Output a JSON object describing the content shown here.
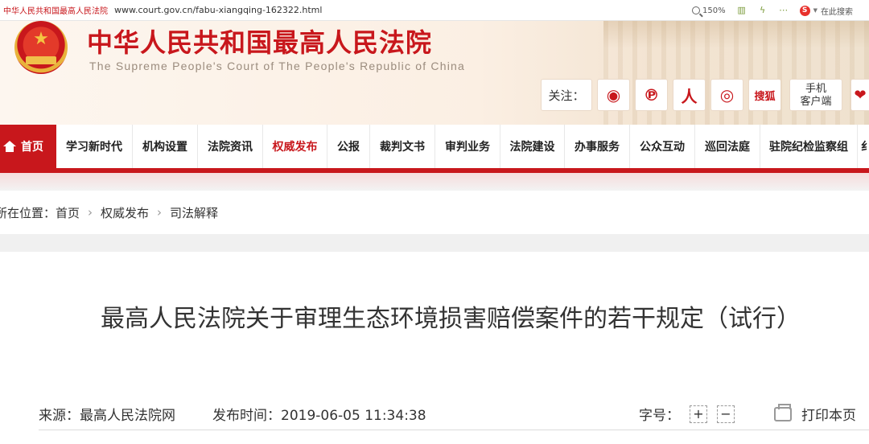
{
  "browser": {
    "tab_title": "中华人民共和国最高人民法院",
    "url": "www.court.gov.cn/fabu-xiangqing-162322.html",
    "zoom": "150%",
    "search_label": "在此搜索"
  },
  "header": {
    "title": "中华人民共和国最高人民法院",
    "subtitle": "The Supreme People's Court of The People's Republic of China",
    "follow_label": "关注：",
    "social": [
      {
        "name": "weibo-icon",
        "glyph": "◉"
      },
      {
        "name": "pinterest-icon",
        "glyph": "℗"
      },
      {
        "name": "renmin-icon",
        "glyph": "人"
      },
      {
        "name": "wechat-icon",
        "glyph": "◎"
      },
      {
        "name": "sohu-icon",
        "glyph": "搜狐"
      }
    ],
    "mobile_line1": "手机",
    "mobile_line2": "客户端"
  },
  "nav": {
    "home": "首页",
    "items": [
      "学习新时代",
      "机构设置",
      "法院资讯",
      "权威发布",
      "公报",
      "裁判文书",
      "审判业务",
      "法院建设",
      "办事服务",
      "公众互动",
      "巡回法庭",
      "驻院纪检监察组"
    ],
    "active": "权威发布",
    "overflow": "纟"
  },
  "breadcrumb": {
    "prefix": "所在位置：",
    "items": [
      "首页",
      "权威发布",
      "司法解释"
    ]
  },
  "article": {
    "title": "最高人民法院关于审理生态环境损害赔偿案件的若干规定（试行）",
    "source": "来源：最高人民法院网",
    "published": "发布时间：2019-06-05 11:34:38",
    "font_size_label": "字号：",
    "increase": "+",
    "decrease": "−",
    "print_label": "打印本页"
  },
  "colors": {
    "brand_red": "#c8171c",
    "subtitle_gray": "#9b8c7e"
  }
}
